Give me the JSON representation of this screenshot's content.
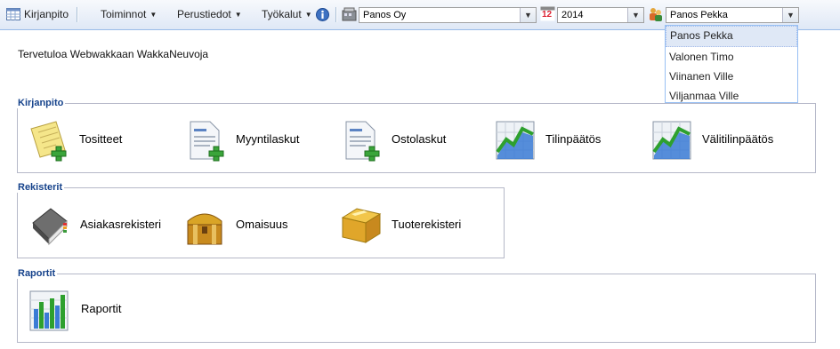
{
  "toolbar": {
    "kirjanpito": "Kirjanpito",
    "toiminnot": "Toiminnot",
    "perustiedot": "Perustiedot",
    "tyokalut": "Työkalut",
    "company": "Panos Oy",
    "calendar_day": "12",
    "year": "2014",
    "user": "Panos Pekka"
  },
  "user_dropdown": {
    "options": [
      "Panos Pekka",
      "Valonen Timo",
      "Viinanen Ville",
      "Viljanmaa Ville"
    ],
    "selected_index": 0
  },
  "welcome": "Tervetuloa Webwakkaan WakkaNeuvoja",
  "sections": {
    "kirjanpito": {
      "title": "Kirjanpito",
      "items": [
        "Tositteet",
        "Myyntilaskut",
        "Ostolaskut",
        "Tilinpäätös",
        "Välitilinpäätös"
      ]
    },
    "rekisterit": {
      "title": "Rekisterit",
      "items": [
        "Asiakasrekisteri",
        "Omaisuus",
        "Tuoterekisteri"
      ]
    },
    "raportit": {
      "title": "Raportit",
      "items": [
        "Raportit"
      ]
    }
  },
  "icons": {
    "kirjanpito_items": [
      "note-add-icon",
      "document-add-icon",
      "document-add-icon",
      "chart-icon",
      "chart-icon"
    ],
    "rekisterit_items": [
      "address-book-icon",
      "treasure-chest-icon",
      "box-icon"
    ],
    "raportit_items": [
      "bar-chart-icon"
    ]
  }
}
